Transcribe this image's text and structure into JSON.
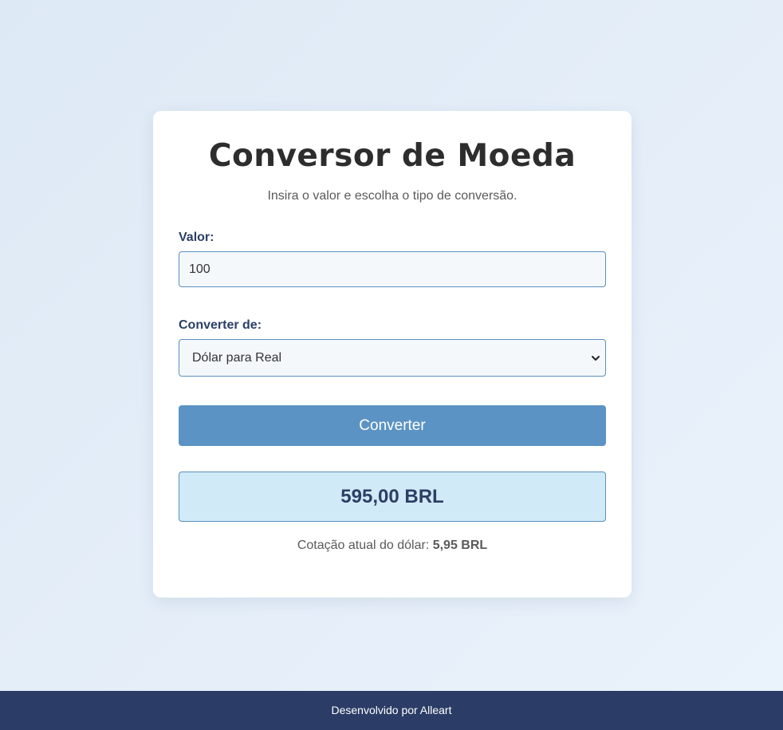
{
  "converter": {
    "title": "Conversor de Moeda",
    "subtitle": "Insira o valor e escolha o tipo de conversão.",
    "amount": {
      "label": "Valor:",
      "value": "100"
    },
    "conversion": {
      "label": "Converter de:",
      "selected": "Dólar para Real"
    },
    "button_label": "Converter",
    "result": "595,00 BRL",
    "rate": {
      "prefix": "Cotação atual do dólar:",
      "value": "5,95 BRL"
    }
  },
  "footer": {
    "text": "Desenvolvido por Alleart"
  },
  "colors": {
    "primary_button": "#5b93c4",
    "result_background": "#d1eaf7",
    "footer_background": "#2b3c66",
    "label_text": "#2b3f66"
  },
  "icons": {
    "select_chevron": "chevron-down-icon"
  }
}
